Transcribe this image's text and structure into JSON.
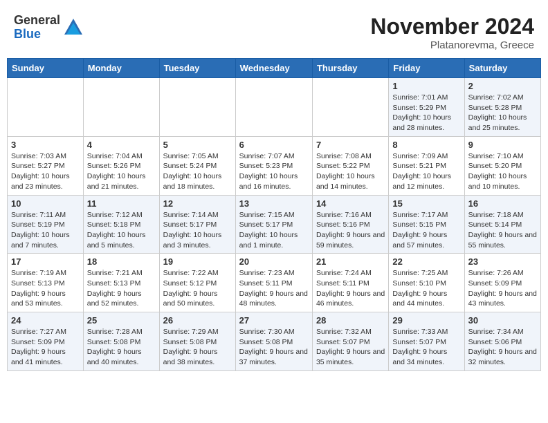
{
  "header": {
    "logo_general": "General",
    "logo_blue": "Blue",
    "month_title": "November 2024",
    "location": "Platanorevma, Greece"
  },
  "weekdays": [
    "Sunday",
    "Monday",
    "Tuesday",
    "Wednesday",
    "Thursday",
    "Friday",
    "Saturday"
  ],
  "weeks": [
    [
      {
        "day": "",
        "info": ""
      },
      {
        "day": "",
        "info": ""
      },
      {
        "day": "",
        "info": ""
      },
      {
        "day": "",
        "info": ""
      },
      {
        "day": "",
        "info": ""
      },
      {
        "day": "1",
        "info": "Sunrise: 7:01 AM\nSunset: 5:29 PM\nDaylight: 10 hours and 28 minutes."
      },
      {
        "day": "2",
        "info": "Sunrise: 7:02 AM\nSunset: 5:28 PM\nDaylight: 10 hours and 25 minutes."
      }
    ],
    [
      {
        "day": "3",
        "info": "Sunrise: 7:03 AM\nSunset: 5:27 PM\nDaylight: 10 hours and 23 minutes."
      },
      {
        "day": "4",
        "info": "Sunrise: 7:04 AM\nSunset: 5:26 PM\nDaylight: 10 hours and 21 minutes."
      },
      {
        "day": "5",
        "info": "Sunrise: 7:05 AM\nSunset: 5:24 PM\nDaylight: 10 hours and 18 minutes."
      },
      {
        "day": "6",
        "info": "Sunrise: 7:07 AM\nSunset: 5:23 PM\nDaylight: 10 hours and 16 minutes."
      },
      {
        "day": "7",
        "info": "Sunrise: 7:08 AM\nSunset: 5:22 PM\nDaylight: 10 hours and 14 minutes."
      },
      {
        "day": "8",
        "info": "Sunrise: 7:09 AM\nSunset: 5:21 PM\nDaylight: 10 hours and 12 minutes."
      },
      {
        "day": "9",
        "info": "Sunrise: 7:10 AM\nSunset: 5:20 PM\nDaylight: 10 hours and 10 minutes."
      }
    ],
    [
      {
        "day": "10",
        "info": "Sunrise: 7:11 AM\nSunset: 5:19 PM\nDaylight: 10 hours and 7 minutes."
      },
      {
        "day": "11",
        "info": "Sunrise: 7:12 AM\nSunset: 5:18 PM\nDaylight: 10 hours and 5 minutes."
      },
      {
        "day": "12",
        "info": "Sunrise: 7:14 AM\nSunset: 5:17 PM\nDaylight: 10 hours and 3 minutes."
      },
      {
        "day": "13",
        "info": "Sunrise: 7:15 AM\nSunset: 5:17 PM\nDaylight: 10 hours and 1 minute."
      },
      {
        "day": "14",
        "info": "Sunrise: 7:16 AM\nSunset: 5:16 PM\nDaylight: 9 hours and 59 minutes."
      },
      {
        "day": "15",
        "info": "Sunrise: 7:17 AM\nSunset: 5:15 PM\nDaylight: 9 hours and 57 minutes."
      },
      {
        "day": "16",
        "info": "Sunrise: 7:18 AM\nSunset: 5:14 PM\nDaylight: 9 hours and 55 minutes."
      }
    ],
    [
      {
        "day": "17",
        "info": "Sunrise: 7:19 AM\nSunset: 5:13 PM\nDaylight: 9 hours and 53 minutes."
      },
      {
        "day": "18",
        "info": "Sunrise: 7:21 AM\nSunset: 5:13 PM\nDaylight: 9 hours and 52 minutes."
      },
      {
        "day": "19",
        "info": "Sunrise: 7:22 AM\nSunset: 5:12 PM\nDaylight: 9 hours and 50 minutes."
      },
      {
        "day": "20",
        "info": "Sunrise: 7:23 AM\nSunset: 5:11 PM\nDaylight: 9 hours and 48 minutes."
      },
      {
        "day": "21",
        "info": "Sunrise: 7:24 AM\nSunset: 5:11 PM\nDaylight: 9 hours and 46 minutes."
      },
      {
        "day": "22",
        "info": "Sunrise: 7:25 AM\nSunset: 5:10 PM\nDaylight: 9 hours and 44 minutes."
      },
      {
        "day": "23",
        "info": "Sunrise: 7:26 AM\nSunset: 5:09 PM\nDaylight: 9 hours and 43 minutes."
      }
    ],
    [
      {
        "day": "24",
        "info": "Sunrise: 7:27 AM\nSunset: 5:09 PM\nDaylight: 9 hours and 41 minutes."
      },
      {
        "day": "25",
        "info": "Sunrise: 7:28 AM\nSunset: 5:08 PM\nDaylight: 9 hours and 40 minutes."
      },
      {
        "day": "26",
        "info": "Sunrise: 7:29 AM\nSunset: 5:08 PM\nDaylight: 9 hours and 38 minutes."
      },
      {
        "day": "27",
        "info": "Sunrise: 7:30 AM\nSunset: 5:08 PM\nDaylight: 9 hours and 37 minutes."
      },
      {
        "day": "28",
        "info": "Sunrise: 7:32 AM\nSunset: 5:07 PM\nDaylight: 9 hours and 35 minutes."
      },
      {
        "day": "29",
        "info": "Sunrise: 7:33 AM\nSunset: 5:07 PM\nDaylight: 9 hours and 34 minutes."
      },
      {
        "day": "30",
        "info": "Sunrise: 7:34 AM\nSunset: 5:06 PM\nDaylight: 9 hours and 32 minutes."
      }
    ]
  ]
}
